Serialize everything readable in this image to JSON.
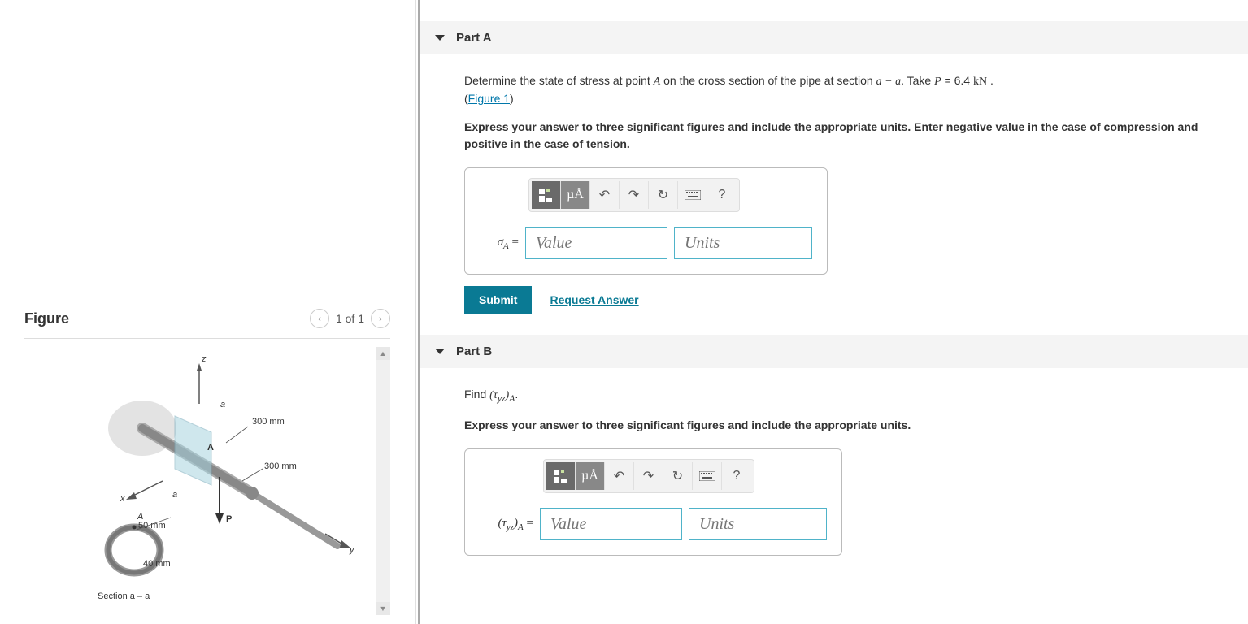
{
  "figure": {
    "title": "Figure",
    "nav_label": "1 of 1",
    "dim1": "300 mm",
    "dim2": "300 mm",
    "dim3": "50 mm",
    "dim4": "40 mm",
    "force_label": "P",
    "point_label": "A",
    "axis_x": "x",
    "axis_y": "y",
    "axis_z": "z",
    "sec_a1": "a",
    "sec_a2": "a",
    "section_label": "Section a – a"
  },
  "partA": {
    "title": "Part A",
    "prompt_prefix": "Determine the state of stress at point ",
    "prompt_point": "A",
    "prompt_mid": " on the cross section of the pipe at section ",
    "prompt_sec": "a − a",
    "prompt_take": ". Take ",
    "prompt_var": "P",
    "prompt_val": " = 6.4 ",
    "prompt_unit": "kN",
    "prompt_end": " .",
    "figure_link": "Figure 1",
    "instructions": "Express your answer to three significant figures and include the appropriate units. Enter negative value in the case of compression and positive in the case of tension.",
    "sigma_html": "σ",
    "sigma_sub": "A",
    "value_placeholder": "Value",
    "units_placeholder": "Units",
    "units_btn": "µÅ",
    "submit": "Submit",
    "request": "Request Answer",
    "help": "?"
  },
  "partB": {
    "title": "Part B",
    "prompt_prefix": "Find ",
    "prompt_var": "(τ",
    "prompt_sub": "yz",
    "prompt_close": ")",
    "prompt_A": "A",
    "prompt_end": ".",
    "instructions": "Express your answer to three significant figures and include the appropriate units.",
    "label_open": "(τ",
    "label_sub": "yz",
    "label_close": ")",
    "label_A": "A",
    "value_placeholder": "Value",
    "units_placeholder": "Units",
    "units_btn": "µÅ",
    "help": "?"
  }
}
